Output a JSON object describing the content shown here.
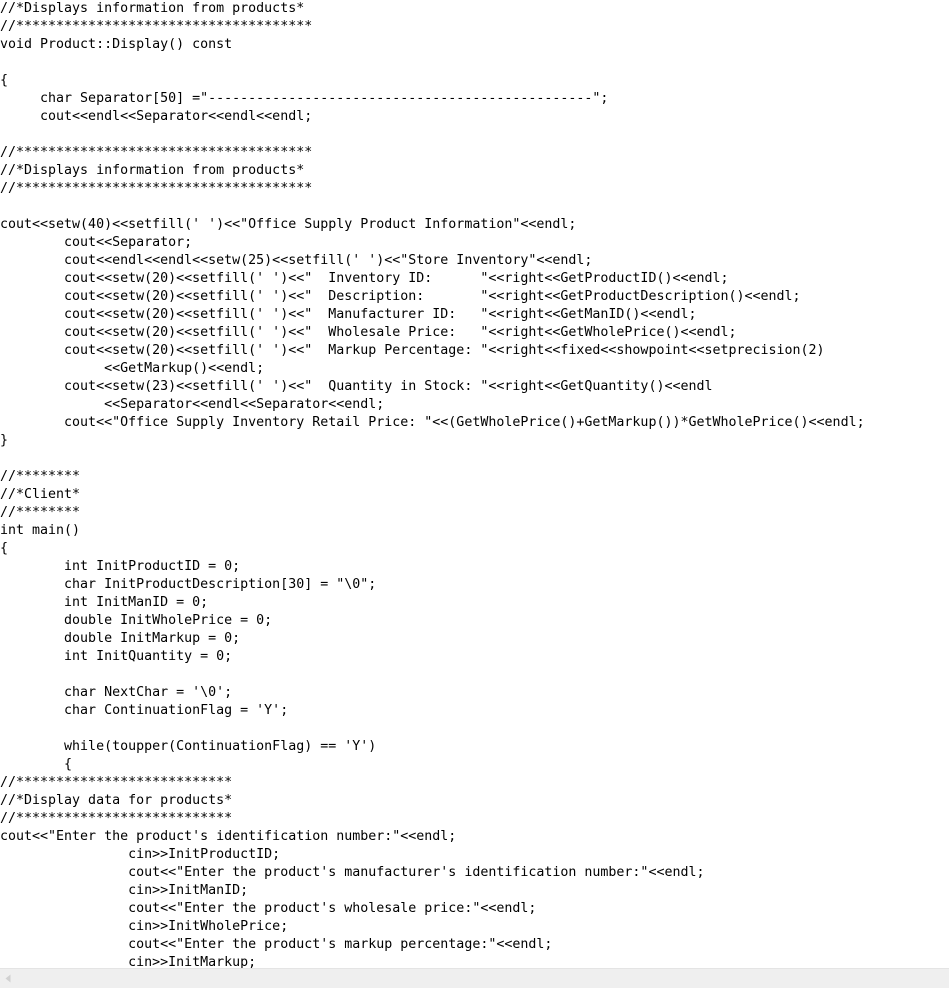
{
  "document": {
    "type": "source-code-listing",
    "language": "C++",
    "background_color": "#ffffff",
    "text_color": "#000000",
    "lines": [
      "//*Displays information from products*",
      "//*************************************",
      "void Product::Display() const",
      "",
      "{",
      "     char Separator[50] =\"------------------------------------------------\";",
      "     cout<<endl<<Separator<<endl<<endl;",
      "",
      "//*************************************",
      "//*Displays information from products*",
      "//*************************************",
      "",
      "cout<<setw(40)<<setfill(' ')<<\"Office Supply Product Information\"<<endl;",
      "        cout<<Separator;",
      "        cout<<endl<<endl<<setw(25)<<setfill(' ')<<\"Store Inventory\"<<endl;",
      "        cout<<setw(20)<<setfill(' ')<<\"  Inventory ID:      \"<<right<<GetProductID()<<endl;",
      "        cout<<setw(20)<<setfill(' ')<<\"  Description:       \"<<right<<GetProductDescription()<<endl;",
      "        cout<<setw(20)<<setfill(' ')<<\"  Manufacturer ID:   \"<<right<<GetManID()<<endl;",
      "        cout<<setw(20)<<setfill(' ')<<\"  Wholesale Price:   \"<<right<<GetWholePrice()<<endl;",
      "        cout<<setw(20)<<setfill(' ')<<\"  Markup Percentage: \"<<right<<fixed<<showpoint<<setprecision(2)",
      "             <<GetMarkup()<<endl;",
      "        cout<<setw(23)<<setfill(' ')<<\"  Quantity in Stock: \"<<right<<GetQuantity()<<endl",
      "             <<Separator<<endl<<Separator<<endl;",
      "        cout<<\"Office Supply Inventory Retail Price: \"<<(GetWholePrice()+GetMarkup())*GetWholePrice()<<endl;",
      "}",
      "",
      "//********",
      "//*Client*",
      "//********",
      "int main()",
      "{",
      "        int InitProductID = 0;",
      "        char InitProductDescription[30] = \"\\0\";",
      "        int InitManID = 0;",
      "        double InitWholePrice = 0;",
      "        double InitMarkup = 0;",
      "        int InitQuantity = 0;",
      "",
      "        char NextChar = '\\0';",
      "        char ContinuationFlag = 'Y';",
      "",
      "        while(toupper(ContinuationFlag) == 'Y')",
      "        {",
      "//***************************",
      "//*Display data for products*",
      "//***************************",
      "cout<<\"Enter the product's identification number:\"<<endl;",
      "                cin>>InitProductID;",
      "                cout<<\"Enter the product's manufacturer's identification number:\"<<endl;",
      "                cin>>InitManID;",
      "                cout<<\"Enter the product's wholesale price:\"<<endl;",
      "                cin>>InitWholePrice;",
      "                cout<<\"Enter the product's markup percentage:\"<<endl;",
      "                cin>>InitMarkup;"
    ]
  },
  "scrollbar": {
    "orientation": "horizontal",
    "track_color": "#efefef",
    "left_arrow_icon": "scroll-left-arrow-icon"
  }
}
